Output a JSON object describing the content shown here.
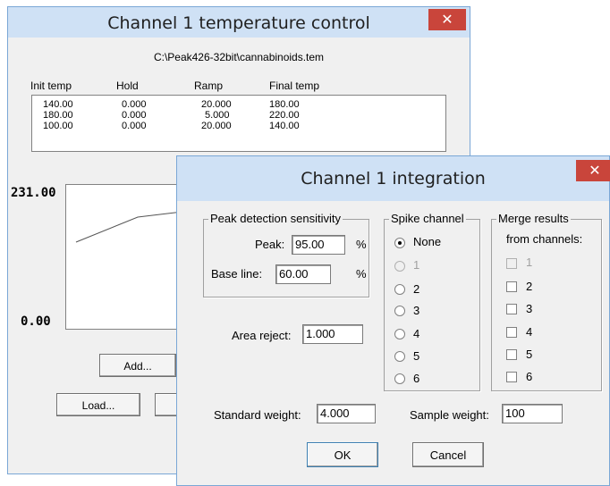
{
  "temp_dialog": {
    "title": "Channel 1 temperature control",
    "close_symbol": "✕",
    "file_path": "C:\\Peak426-32bit\\cannabinoids.tem",
    "columns": [
      "Init temp",
      "Hold",
      "Ramp",
      "Final temp"
    ],
    "rows": [
      [
        "140.00",
        "0.000",
        "20.000",
        "180.00"
      ],
      [
        "180.00",
        "0.000",
        "5.000",
        "220.00"
      ],
      [
        "100.00",
        "0.000",
        "20.000",
        "140.00"
      ]
    ],
    "graph": {
      "y_max_label": "231.00",
      "y_min_label": "0.00"
    },
    "add_label": "Add...",
    "load_label": "Load..."
  },
  "integration_dialog": {
    "title": "Channel 1 integration",
    "close_symbol": "✕",
    "peak_detection": {
      "title": "Peak detection sensitivity",
      "peak_label": "Peak:",
      "peak_value": "95.00",
      "peak_unit": "%",
      "baseline_label": "Base line:",
      "baseline_value": "60.00",
      "baseline_unit": "%"
    },
    "area_reject": {
      "label": "Area reject:",
      "value": "1.000"
    },
    "spike_channel": {
      "title": "Spike channel",
      "options": [
        "None",
        "1",
        "2",
        "3",
        "4",
        "5",
        "6"
      ],
      "selected": "None",
      "disabled": [
        "1"
      ]
    },
    "merge_results": {
      "title_line1": "Merge results",
      "title_line2": "from channels:",
      "options": [
        "1",
        "2",
        "3",
        "4",
        "5",
        "6"
      ],
      "disabled": [
        "1"
      ]
    },
    "standard_weight": {
      "label": "Standard weight:",
      "value": "4.000"
    },
    "sample_weight": {
      "label": "Sample weight:",
      "value": "100"
    },
    "ok_label": "OK",
    "cancel_label": "Cancel"
  },
  "colors": {
    "title_bar": "#cfe1f5",
    "dialog_bg": "#f0f0f0",
    "close_button": "#c9453b",
    "border": "#7aa7d6"
  }
}
